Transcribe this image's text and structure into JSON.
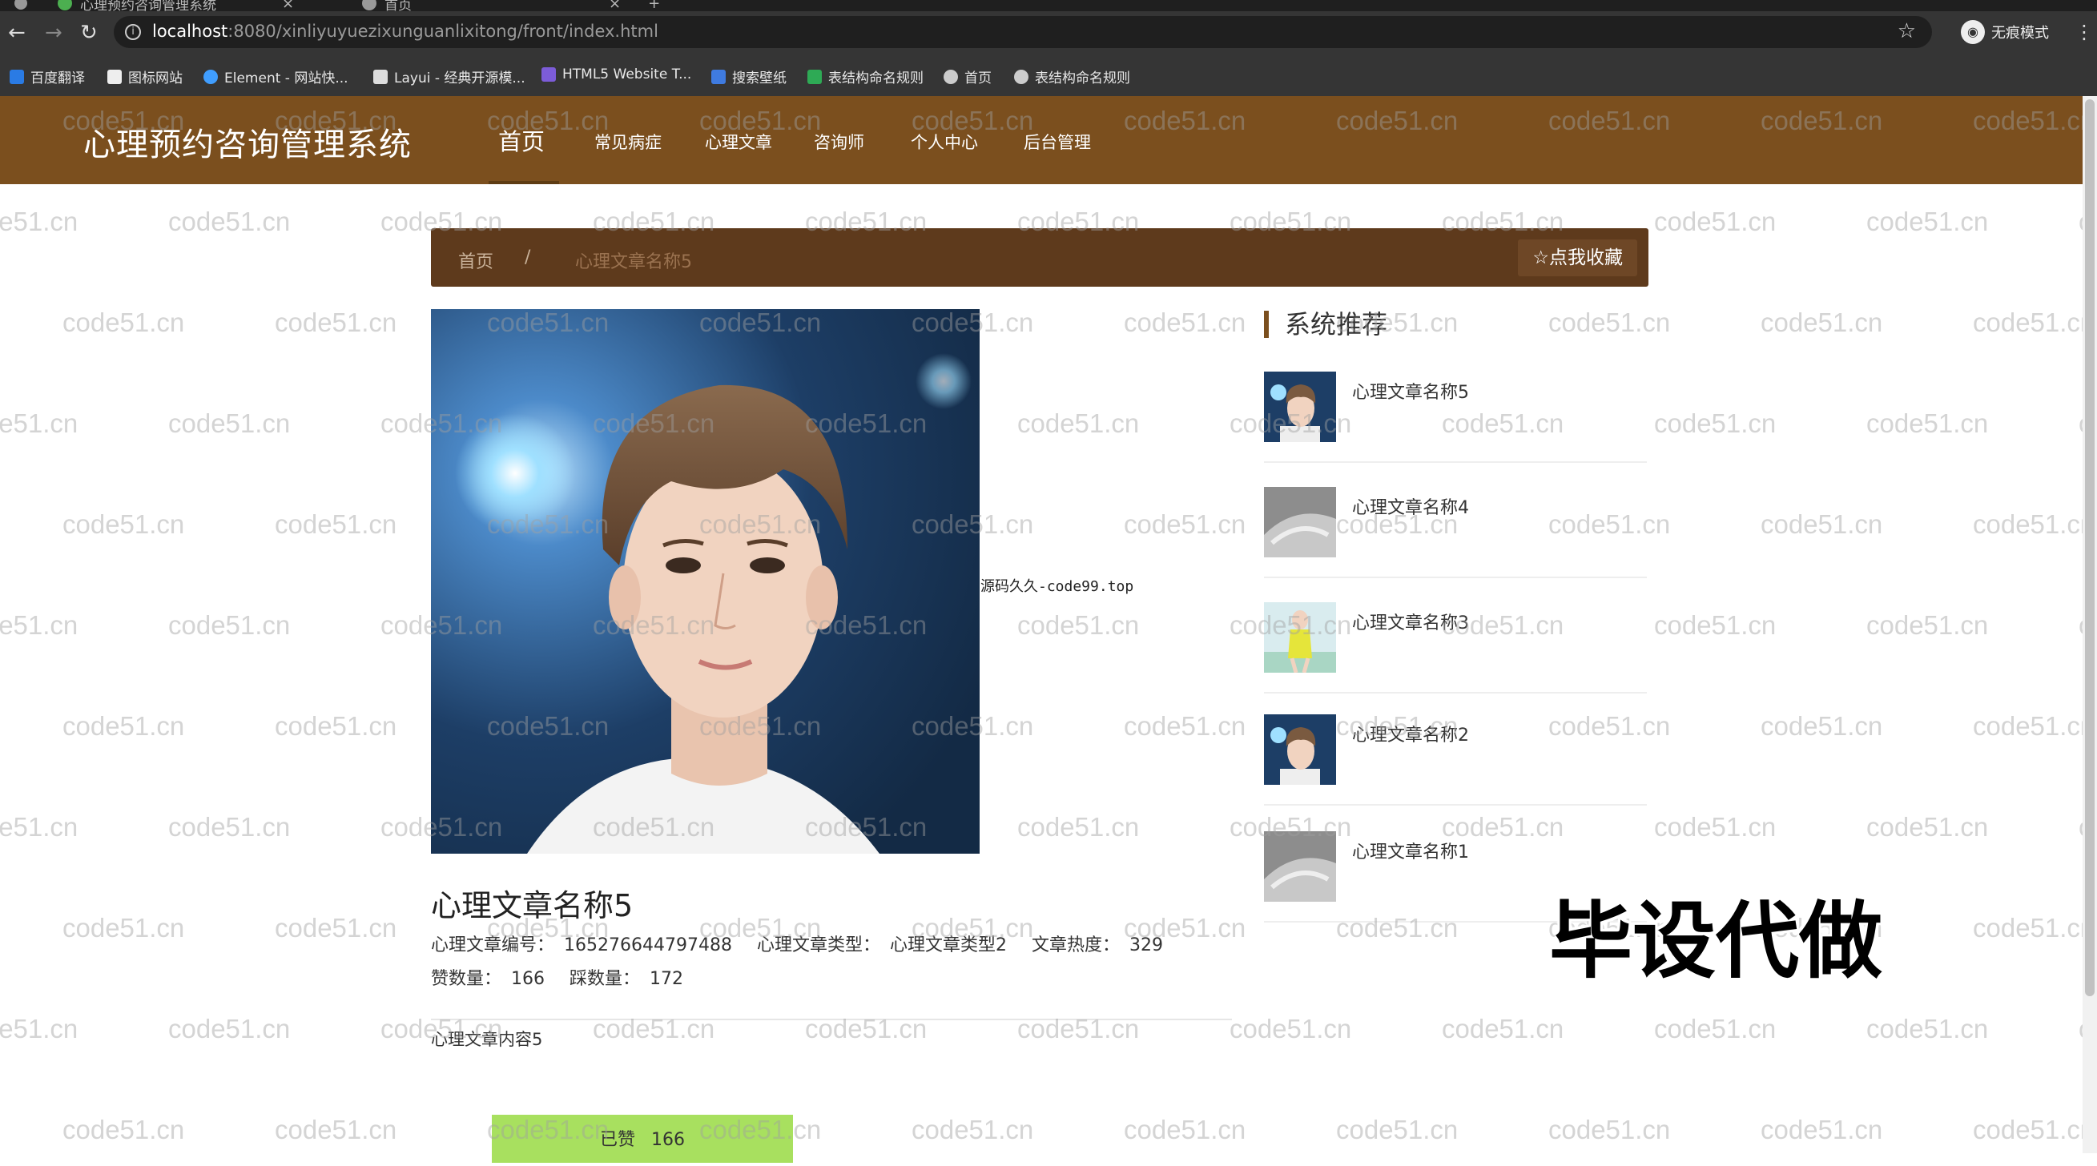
{
  "browser": {
    "tabs": [
      {
        "title": "心理预约咨询管理系统"
      },
      {
        "title": "首页"
      }
    ],
    "url_host": "localhost",
    "url_rest": ":8080/xinliyuyuezixunguanlixitong/front/index.html",
    "incognito_label": "无痕模式",
    "bookmarks": [
      "百度翻译",
      "图标网站",
      "Element - 网站快...",
      "Layui - 经典开源模...",
      "HTML5 Website T...",
      "搜索壁纸",
      "表结构命名规则",
      "首页",
      "表结构命名规则"
    ]
  },
  "site": {
    "title": "心理预约咨询管理系统",
    "nav": [
      "首页",
      "常见病症",
      "心理文章",
      "咨询师",
      "个人中心",
      "后台管理"
    ]
  },
  "breadcrumb": {
    "home": "首页",
    "separator": "/",
    "current": "心理文章名称5",
    "favorite_button": "☆点我收藏"
  },
  "article": {
    "title": "心理文章名称5",
    "id_label": "心理文章编号：",
    "id_value": "165276644797488",
    "type_label": "心理文章类型：",
    "type_value": "心理文章类型2",
    "heat_label": "文章热度：",
    "heat_value": "329",
    "likes_label": "赞数量：",
    "likes_value": "166",
    "dislikes_label": "踩数量：",
    "dislikes_value": "172",
    "content": "心理文章内容5",
    "liked_label": "已赞",
    "liked_count": "166"
  },
  "overlay_text": "源码久久-code99.top",
  "recommend": {
    "title": "系统推荐",
    "items": [
      {
        "name": "心理文章名称5",
        "thumb": "portrait"
      },
      {
        "name": "心理文章名称4",
        "thumb": "grey"
      },
      {
        "name": "心理文章名称3",
        "thumb": "yellow"
      },
      {
        "name": "心理文章名称2",
        "thumb": "portrait"
      },
      {
        "name": "心理文章名称1",
        "thumb": "grey"
      }
    ]
  },
  "watermark": "code51.cn",
  "promo_text": "毕设代做",
  "colors": {
    "header": "#7b4f1e",
    "breadcrumb": "#5e3a1c",
    "like_button": "#a8e05f"
  }
}
